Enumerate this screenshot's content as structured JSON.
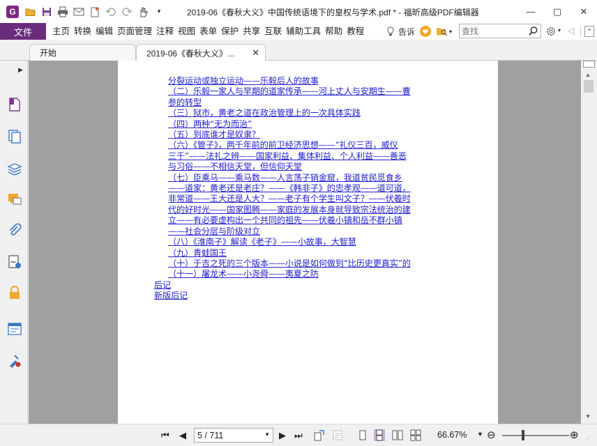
{
  "window": {
    "title": "2019-06《春秋大义》中国传统语境下的皇权与学术.pdf * - 福昕高级PDF编辑器",
    "logo_letter": "G",
    "minimize": "—",
    "maximize": "▢",
    "close": "✕"
  },
  "menu": {
    "file": "文件",
    "items": [
      "主页",
      "转换",
      "编辑",
      "页面管理",
      "注释",
      "视图",
      "表单",
      "保护",
      "共享",
      "互联",
      "辅助工具",
      "帮助",
      "教程"
    ],
    "hint": "告诉",
    "search_placeholder": "查找"
  },
  "tabs": [
    {
      "label": "开始"
    },
    {
      "label": "2019-06《春秋大义》...",
      "close": "✕"
    }
  ],
  "toc": [
    {
      "text": "分裂运动或独立运动——乐毅后人的故事",
      "level": 1
    },
    {
      "text": "（二）乐毅一家人与早期的道家传承——河上丈人与安期生——曹",
      "level": 0
    },
    {
      "text": "参的转型",
      "level": 1
    },
    {
      "text": "（三）狱市，黄老之道在政治管理上的一次具体实践",
      "level": 0
    },
    {
      "text": "（四）两种“无为而治”",
      "level": 0
    },
    {
      "text": "（五）到底谁才是奴隶？",
      "level": 0
    },
    {
      "text": "（六）《管子》，两千年前的前卫经济思想——“礼仪三百，威仪",
      "level": 0
    },
    {
      "text": "三千”——法礼之辨——国家利益、集体利益、个人利益——善恶",
      "level": 1
    },
    {
      "text": "与习俗——不相信天堂，但信仰天堂",
      "level": 1
    },
    {
      "text": "（七）臣乘马——乘马数——人言荡子销金窟，我道贫民觅食乡",
      "level": 0
    },
    {
      "text": "——道家：黄老还是老庄？——《韩非子》的忠孝观——道可道，",
      "level": 1
    },
    {
      "text": "非常道——王大还是人大？——老子有个学生叫文子？——伏羲时",
      "level": 1
    },
    {
      "text": "代的好时光——国家图腾——家庭的发展本身就导致宗法统治的建",
      "level": 1
    },
    {
      "text": "立——有必要虚构出一个共同的祖先——伏羲小镇和岳不群小镇",
      "level": 1
    },
    {
      "text": "——社会分层与阶级对立",
      "level": 1
    },
    {
      "text": "（八）《淮南子》解读《老子》——小故事，大智慧",
      "level": 0
    },
    {
      "text": "（九）青蛙国王",
      "level": 0
    },
    {
      "text": "（十）于吉之死的三个版本——小说是如何做到“比历史更真实”的",
      "level": 0
    },
    {
      "text": "（十一）屠龙术——小尧舜——夷夏之防",
      "level": 0
    },
    {
      "text": "后记",
      "level": -1
    },
    {
      "text": "新版后记",
      "level": -1
    }
  ],
  "status": {
    "page_indicator": "5 / 711",
    "zoom": "66.67%"
  },
  "colors": {
    "accent": "#6a2d7d",
    "link": "#2222cc",
    "doc_bg": "#a0a0a0"
  },
  "icons": [
    "app-logo-icon",
    "open-folder-icon",
    "save-icon",
    "print-icon",
    "email-icon",
    "new-icon",
    "undo-icon",
    "redo-icon",
    "hand-tool-icon",
    "lightbulb-icon",
    "heart-icon",
    "search-folder-icon",
    "search-icon",
    "settings-icon",
    "back-icon"
  ]
}
